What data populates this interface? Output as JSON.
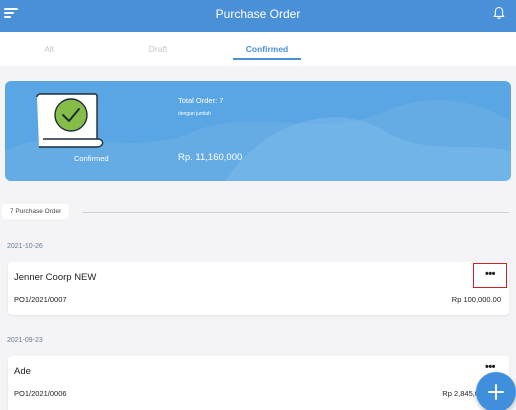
{
  "header": {
    "title": "Purchase Order",
    "menu_icon": "hamburger-menu-icon",
    "bell_icon": "notification-bell-icon"
  },
  "tabs": [
    {
      "label": "All",
      "active": false
    },
    {
      "label": "Draft",
      "active": false
    },
    {
      "label": "Confirmed",
      "active": true
    }
  ],
  "summary": {
    "status_label": "Confirmed",
    "total_order_text": "Total Order: 7",
    "subtitle": "dengan jumlah",
    "total_amount": "Rp. 11,160,000",
    "icon": "document-check-icon"
  },
  "list": {
    "count_label": "7 Purchase Order"
  },
  "orders": [
    {
      "date": "2021-10-26",
      "name": "Jenner Coorp NEW",
      "number": "PO1/2021/0007",
      "amount": "Rp 100,000.00",
      "more": "•••"
    },
    {
      "date": "2021-09-23",
      "name": "Ade",
      "number": "PO1/2021/0006",
      "amount": "Rp 2,845,0",
      "more": "•••"
    }
  ],
  "colors": {
    "primary": "#4a90d9",
    "summary_card": "#5aa5e3",
    "check_circle": "#86bd49",
    "highlight_border": "#d21f1f"
  },
  "fab_icon": "plus-icon"
}
